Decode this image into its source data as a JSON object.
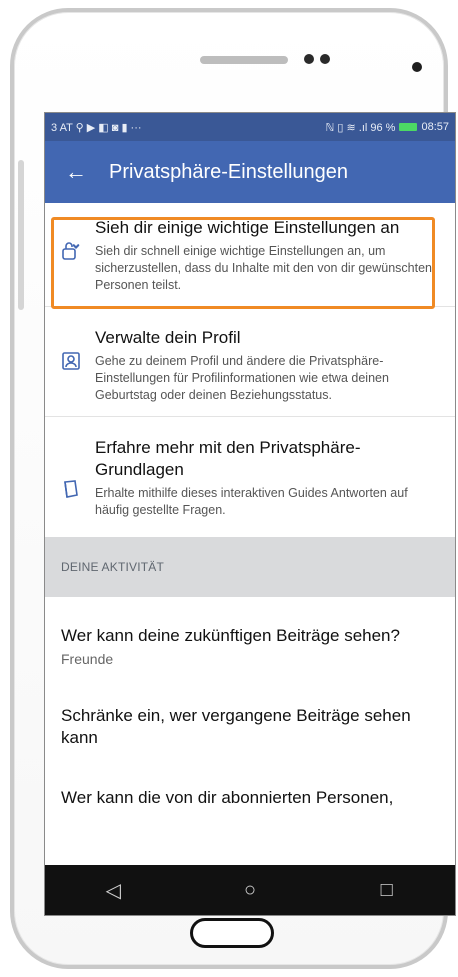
{
  "status_bar": {
    "left_text": "3 AT ⚲ ▶ ◧ ◙ ▮ ···",
    "right_text": "ℕ ▯ ≋ .ıl 96 %",
    "time": "08:57"
  },
  "app_bar": {
    "back_icon": "arrow-left",
    "title": "Privatsphäre-Einstellungen"
  },
  "sections": [
    {
      "icon": "lock-heart-icon",
      "title": "Sieh dir einige wichtige Einstellungen an",
      "description": "Sieh dir schnell einige wichtige Einstellungen an, um sicherzustellen, dass du Inhalte mit den von dir gewünschten Personen teilst."
    },
    {
      "icon": "profile-card-icon",
      "title": "Verwalte dein Profil",
      "description": "Gehe zu deinem Profil und ändere die Privatsphäre-Einstellungen für Profilinformationen wie etwa deinen Geburtstag oder deinen Beziehungsstatus."
    },
    {
      "icon": "book-icon",
      "title": "Erfahre mehr mit den Privatsphäre-Grundlagen",
      "description": "Erhalte mithilfe dieses interaktiven Guides Antworten auf häufig gestellte Fragen."
    }
  ],
  "activity": {
    "header": "DEINE AKTIVITÄT",
    "items": [
      {
        "title": "Wer kann deine zukünftigen Beiträge sehen?",
        "value": "Freunde"
      },
      {
        "title": "Schränke ein, wer vergangene Beiträge sehen kann",
        "value": ""
      },
      {
        "title": "Wer kann die von dir abonnierten Personen,",
        "value": ""
      }
    ]
  },
  "nav": {
    "back": "◁",
    "home": "○",
    "recents": "□"
  },
  "colors": {
    "appbar": "#4267b2",
    "statusbar": "#3a5896",
    "highlight": "#f08a24"
  }
}
